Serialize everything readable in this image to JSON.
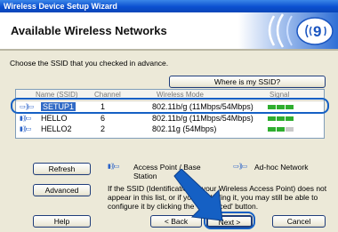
{
  "window": {
    "title": "Wireless Device Setup Wizard"
  },
  "header": {
    "title": "Available Wireless Networks",
    "logo_icon": "wireless-wifi-logo-icon"
  },
  "instruction": "Choose the SSID that you checked in advance.",
  "where_ssid_button": "Where is my SSID?",
  "list": {
    "columns": [
      "Name (SSID)",
      "Channel",
      "Wireless Mode",
      "Signal"
    ],
    "rows": [
      {
        "name": "SETUP1",
        "channel": "1",
        "mode": "802.11b/g (11Mbps/54Mbps)",
        "type_icon": "ad-hoc-network-icon",
        "signal": 3,
        "selected": true
      },
      {
        "name": "HELLO",
        "channel": "6",
        "mode": "802.11b/g (11Mbps/54Mbps)",
        "type_icon": "access-point-icon",
        "signal": 3,
        "selected": false
      },
      {
        "name": "HELLO2",
        "channel": "2",
        "mode": "802.11g (54Mbps)",
        "type_icon": "access-point-icon",
        "signal": 2,
        "selected": false
      }
    ]
  },
  "refresh_button": "Refresh",
  "advanced_button": "Advanced",
  "legend": {
    "ap_label": "Access Point / Base Station",
    "adhoc_label": "Ad-hoc Network",
    "ap_icon": "access-point-icon",
    "adhoc_icon": "ad-hoc-network-icon"
  },
  "advanced_text": "If the SSID (Identification of your Wireless Access Point) does not appear in this list, or if you are hiding it, you may still be able to configure it by clicking the 'Advanced' button.",
  "footer": {
    "help": "Help",
    "back": "< Back",
    "next": "Next >",
    "cancel": "Cancel"
  },
  "colors": {
    "callout": "#1560c4",
    "signal_on": "#2fae2f",
    "signal_off": "#c9c9c9",
    "selection": "#316ac5"
  }
}
